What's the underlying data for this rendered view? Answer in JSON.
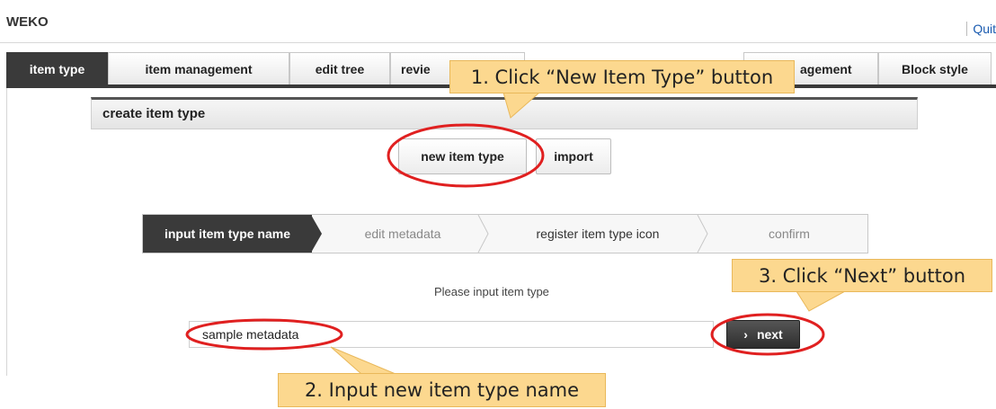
{
  "header": {
    "app_title": "WEKO",
    "quit_label": "Quit"
  },
  "tabs": [
    {
      "label": "item type",
      "active": true
    },
    {
      "label": "item management",
      "active": false
    },
    {
      "label": "edit tree",
      "active": false
    },
    {
      "label": "revie",
      "active": false
    },
    {
      "label": "agement",
      "active": false
    },
    {
      "label": "Block style",
      "active": false
    }
  ],
  "section": {
    "title": "create item type"
  },
  "actions": {
    "new_item_type_label": "new item type",
    "import_label": "import"
  },
  "steps": [
    {
      "label": "input item type name",
      "active": true
    },
    {
      "label": "edit metadata",
      "active": false
    },
    {
      "label": "register item type icon",
      "active": false
    },
    {
      "label": "confirm",
      "active": false
    }
  ],
  "form": {
    "prompt": "Please input item type",
    "name_value": "sample metadata",
    "next_label": "next"
  },
  "callouts": {
    "step1": "1. Click “New Item Type” button",
    "step2": "2. Input new item type name",
    "step3": "3. Click “Next” button"
  },
  "colors": {
    "callout_fill": "#fcd88f",
    "highlight_ring": "#e02020",
    "active_dark": "#3a3a3a"
  }
}
